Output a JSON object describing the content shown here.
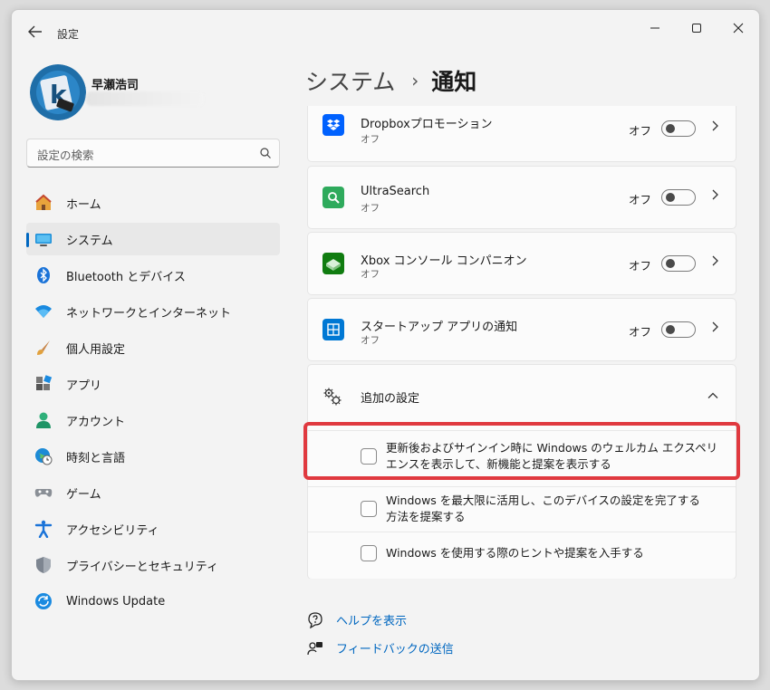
{
  "window": {
    "app_title": "設定",
    "back_icon": "back-arrow-icon",
    "controls": [
      "minimize-icon",
      "maximize-icon",
      "close-icon"
    ]
  },
  "profile": {
    "name": "早瀬浩司"
  },
  "search": {
    "placeholder": "設定の検索"
  },
  "sidebar": {
    "items": [
      {
        "label": "ホーム",
        "icon": "home-icon"
      },
      {
        "label": "システム",
        "icon": "system-icon",
        "active": true
      },
      {
        "label": "Bluetooth とデバイス",
        "icon": "bluetooth-icon"
      },
      {
        "label": "ネットワークとインターネット",
        "icon": "wifi-icon"
      },
      {
        "label": "個人用設定",
        "icon": "brush-icon"
      },
      {
        "label": "アプリ",
        "icon": "apps-icon"
      },
      {
        "label": "アカウント",
        "icon": "account-icon"
      },
      {
        "label": "時刻と言語",
        "icon": "globe-clock-icon"
      },
      {
        "label": "ゲーム",
        "icon": "gamepad-icon"
      },
      {
        "label": "アクセシビリティ",
        "icon": "accessibility-icon"
      },
      {
        "label": "プライバシーとセキュリティ",
        "icon": "shield-icon"
      },
      {
        "label": "Windows Update",
        "icon": "update-icon"
      }
    ]
  },
  "header": {
    "parent": "システム",
    "separator": "›",
    "current": "通知"
  },
  "apps": [
    {
      "name": "Dropboxプロモーション",
      "status": "オフ",
      "toggle_label": "オフ",
      "icon": "dropbox-icon",
      "color": "#0061fe"
    },
    {
      "name": "UltraSearch",
      "status": "オフ",
      "toggle_label": "オフ",
      "icon": "ultrasearch-icon",
      "color": "#2eaa5c"
    },
    {
      "name": "Xbox コンソール コンパニオン",
      "status": "オフ",
      "toggle_label": "オフ",
      "icon": "xbox-icon",
      "color": "#107c10"
    },
    {
      "name": "スタートアップ アプリの通知",
      "status": "オフ",
      "toggle_label": "オフ",
      "icon": "startup-apps-icon",
      "color": "#0078d4"
    }
  ],
  "additional": {
    "title": "追加の設定",
    "options": [
      {
        "line1": "更新後およびサインイン時に Windows のウェルカム エクスペリ",
        "line2": "エンスを表示して、新機能と提案を表示する",
        "checked": false
      },
      {
        "line1": "Windows を最大限に活用し、このデバイスの設定を完了する",
        "line2": "方法を提案する",
        "checked": false
      },
      {
        "line1": "Windows を使用する際のヒントや提案を入手する",
        "line2": "",
        "checked": false
      }
    ]
  },
  "links": {
    "help": "ヘルプを表示",
    "feedback": "フィードバックの送信"
  },
  "colors": {
    "accent": "#0067c0",
    "highlight": "#e0393f"
  }
}
